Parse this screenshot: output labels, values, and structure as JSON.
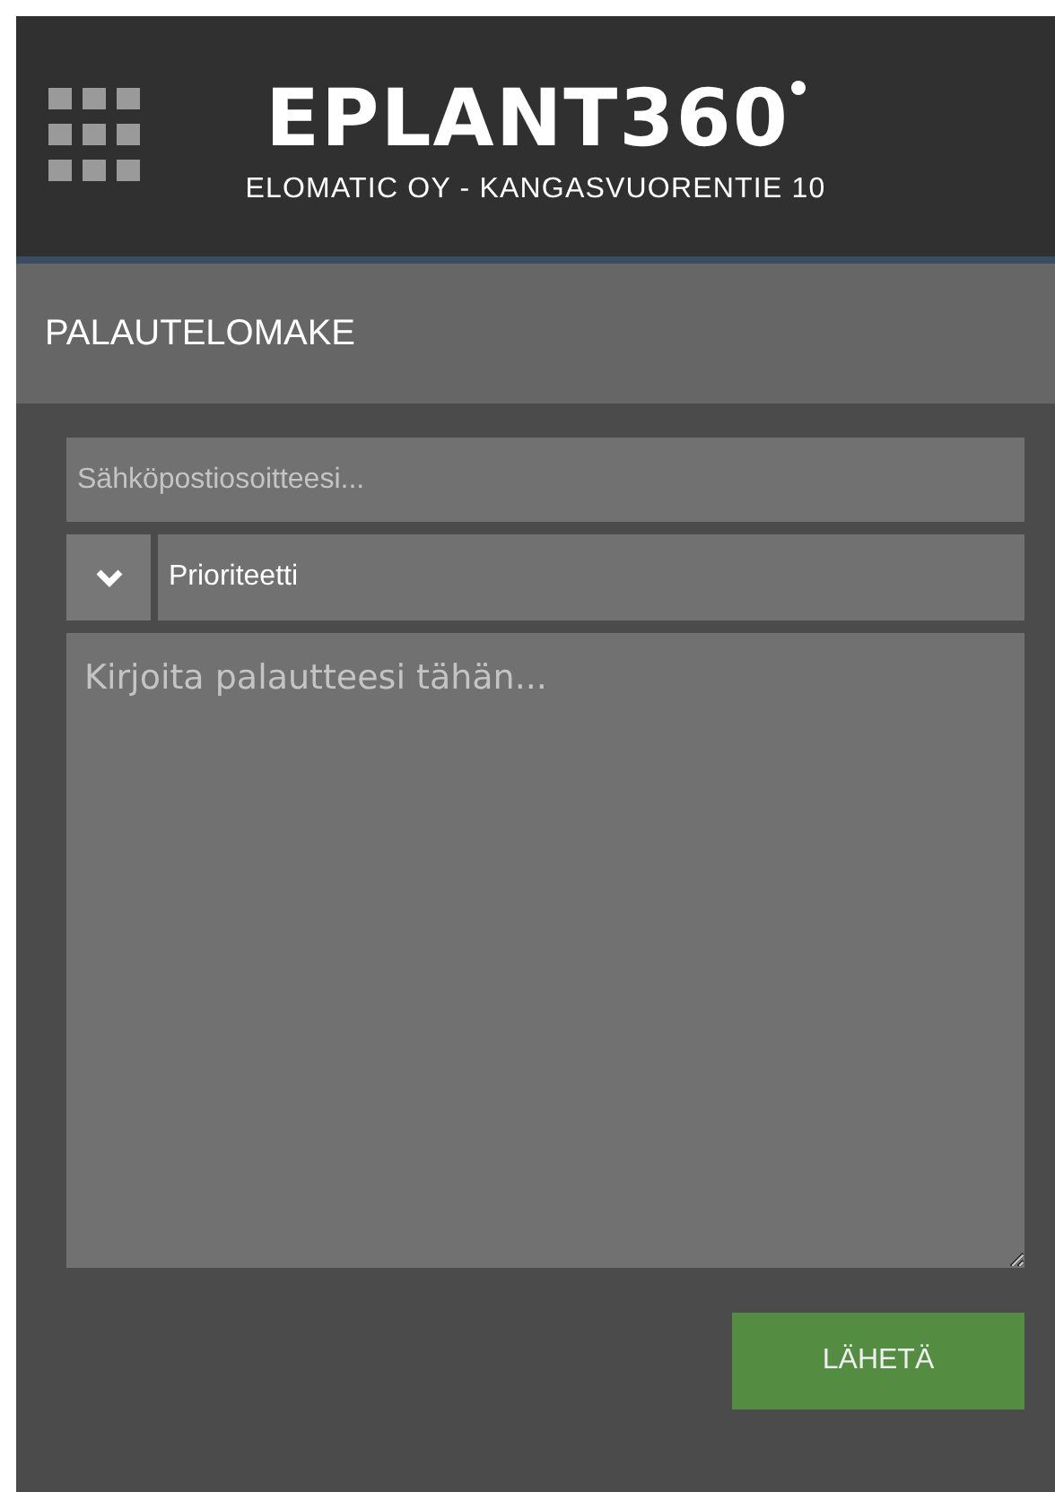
{
  "header": {
    "logo": "EPLANT360",
    "subtitle": "ELOMATIC OY - KANGASVUORENTIE 10"
  },
  "title_bar": {
    "title": "PALAUTELOMAKE"
  },
  "form": {
    "email": {
      "placeholder": "Sähköpostiosoitteesi..."
    },
    "priority": {
      "value": "Prioriteetti"
    },
    "feedback": {
      "placeholder": "Kirjoita palautteesi tähän..."
    },
    "submit": "LÄHETÄ"
  }
}
